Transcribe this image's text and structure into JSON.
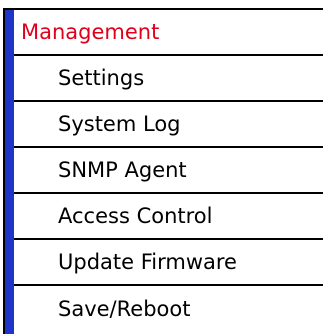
{
  "menu": {
    "title": "Management",
    "colors": {
      "title": "#e0001b",
      "left_bar": "#1f35c8",
      "border": "#000000"
    },
    "items": [
      {
        "label": "Settings"
      },
      {
        "label": "System Log"
      },
      {
        "label": "SNMP Agent"
      },
      {
        "label": "Access Control"
      },
      {
        "label": "Update Firmware"
      },
      {
        "label": "Save/Reboot"
      }
    ]
  }
}
